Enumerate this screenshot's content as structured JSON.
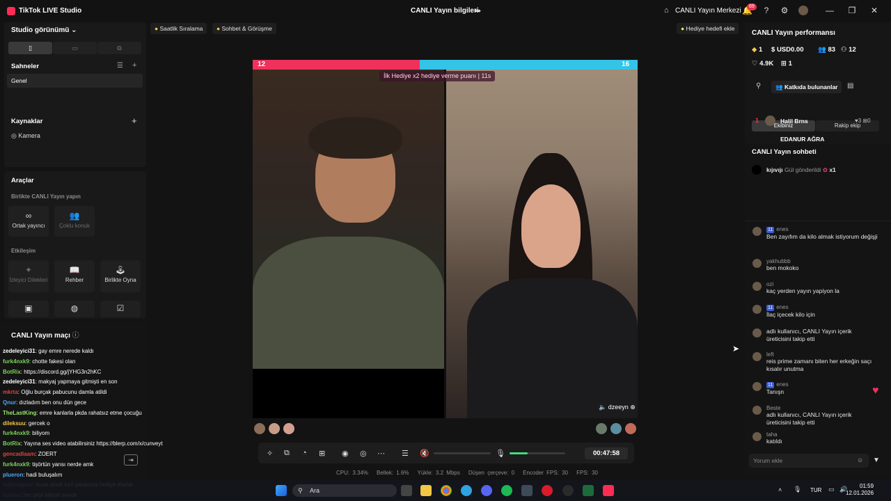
{
  "titlebar": {
    "app_title": "TikTok LIVE Studio",
    "center_title": "CANLI Yayın bilgileri",
    "center_link": "CANLI Yayın Merkezi",
    "notif_count": "69"
  },
  "left": {
    "studio_view": "Studio görünümü",
    "scenes_title": "Sahneler",
    "scene_item": "Genel",
    "sources_title": "Kaynaklar",
    "source_item": "Kamera",
    "tools_title": "Araçlar",
    "together_title": "Birlikte CANLI Yayın yapın",
    "tool_cohost": "Ortak yayıncı",
    "tool_multi": "Çoklu konuk",
    "interaction_title": "Etkileşim",
    "tool_viewer_wishes": "İzleyici Dilekleri",
    "tool_guide": "Rehber",
    "tool_play": "Birlikte Oyna",
    "match_title": "CANLI Yayın maçı"
  },
  "tags": {
    "sales_rank": "Saatlik Sıralama",
    "chat_meet": "Sohbet & Görüşme",
    "gift_goal": "Hediye hedefi ekle"
  },
  "stage": {
    "score_left": "12",
    "score_right": "16",
    "gift_banner": "İlk Hediye x2 hediye verme puanı",
    "gift_timer": "11s",
    "guest_name": "dzeeyn"
  },
  "controls": {
    "timer": "00:47:58"
  },
  "stats": {
    "cpu": "CPU: 3.34%",
    "memory": "Bellek: 1.6%",
    "upload": "Yükle: 3.2 Mbps",
    "dropped": "Düşen çerçeve: 0",
    "encoder_fps": "Encoder FPS: 30",
    "fps": "FPS: 30"
  },
  "right": {
    "perf_title": "CANLI Yayın performansı",
    "diamonds": "1",
    "usd": "USD0.00",
    "viewers": "83",
    "followers": "12",
    "likes": "4.9K",
    "gifts": "1",
    "contributors": "Katkıda bulunanlar",
    "tab_team": "Ekibiniz",
    "tab_rival": "Rakip ekip",
    "rank1_name": "Halil Brns",
    "rank1_hearts": "3",
    "rank1_other": "0",
    "rank2_name": "EDANUR AĞRA",
    "chat_title": "CANLI Yayın sohbeti",
    "pinned_user": "kıjıvıjı",
    "pinned_text": "Gül gönderildi",
    "pinned_count": "x1",
    "comment_placeholder": "Yorum ekle",
    "messages": [
      {
        "name": "enes",
        "level": "11",
        "text": "Ben zayıfım da kilo almak istiyorum değişji"
      },
      {
        "name": "yakhubbb",
        "level": "",
        "text": "ben mokoko"
      },
      {
        "name": "ozi",
        "level": "",
        "text": "kaç yerden yayın yapiyon la"
      },
      {
        "name": "enes",
        "level": "11",
        "text": "İlaç içecek kilo için"
      },
      {
        "name": "",
        "level": "",
        "text": "adlı kullanıcı, CANLI Yayın içerik üreticisini takip etti"
      },
      {
        "name": "left",
        "level": "",
        "text": "reis prime zamanı biten her erkeğin saçı kısalır unutma"
      },
      {
        "name": "enes",
        "level": "11",
        "text": "Tanışn"
      },
      {
        "name": "Beste",
        "level": "",
        "text": "adlı kullanıcı, CANLI Yayın içerik üreticisini takip etti"
      },
      {
        "name": "taha",
        "level": "",
        "text": "katıldı"
      }
    ]
  },
  "left_chat": [
    {
      "user": "zedeleyici31",
      "color": "#ffffff",
      "text": ": gay emre nerede kaldı"
    },
    {
      "user": "furk4nxk9",
      "color": "#7cd35a",
      "text": ": chotte fakesi olan"
    },
    {
      "user": "BotRix",
      "color": "#7cd35a",
      "text": ": https://discord.gg/jYHG3n2hKC"
    },
    {
      "user": "zedeleyici31",
      "color": "#ffffff",
      "text": ": makyaj yapmaya gitmişti en son"
    },
    {
      "user": "mkrta",
      "color": "#e04040",
      "text": ": Oğlu burçak pabucunu damla atildi"
    },
    {
      "user": "Qnur",
      "color": "#4aa8ff",
      "text": ": dızladım ben onu dün gece"
    },
    {
      "user": "TheLastKing",
      "color": "#9ae66e",
      "text": ": emre kanlarla pkda rahatsız etme çocuğu"
    },
    {
      "user": "dileksuu",
      "color": "#f2c744",
      "text": ": gercek o"
    },
    {
      "user": "furk4nxk9",
      "color": "#7cd35a",
      "text": ": biliyom"
    },
    {
      "user": "BotRix",
      "color": "#7cd35a",
      "text": ": Yayına ses video atabilirsiniz https://blerp.com/x/cunveyt"
    },
    {
      "user": "gencadlaam",
      "color": "#e04040",
      "text": ": ZOERT"
    },
    {
      "user": "furk4nxk9",
      "color": "#7cd35a",
      "text": ": tişörtün yarısı nerde amk"
    },
    {
      "user": "plueron",
      "color": "#4aa8ff",
      "text": ": hadi buluşalım"
    },
    {
      "user": "ladyeaglesi",
      "color": "#4aa8ff",
      "text": ": buna simdi tum parasıyla hediye atarlar"
    },
    {
      "user": "sulesu",
      "color": "#4aa8ff",
      "text": ": her şeyi biliyon sende"
    }
  ],
  "taskbar": {
    "search": "Ara",
    "lang": "TUR",
    "time": "01:59",
    "date": "12.01.2026"
  }
}
